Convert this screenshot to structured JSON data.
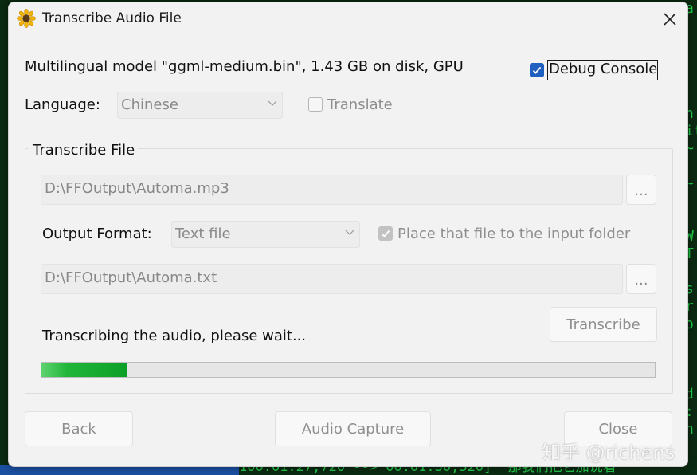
{
  "background": {
    "terminal_right_lines": [
      "a",
      "",
      "",
      "",
      "",
      "",
      "n",
      "it",
      "~",
      "",
      "~",
      "",
      "",
      "W",
      "T",
      "",
      "s",
      "r",
      "o",
      "",
      "",
      "",
      "d",
      ":",
      "h",
      "",
      "",
      "e"
    ],
    "terminal_bottom_text": "100:01:27,720 --> 00:01:30,320]  那我们把它加说着"
  },
  "window": {
    "title": "Transcribe Audio File",
    "model_info": "Multilingual model \"ggml-medium.bin\", 1.43 GB on disk, GPU",
    "debug_console": {
      "label": "Debug Console",
      "checked": true
    },
    "language": {
      "label": "Language:",
      "selected": "Chinese"
    },
    "translate": {
      "label": "Translate",
      "checked": false
    },
    "transcribe_group": {
      "label": "Transcribe File",
      "input_path": "D:\\FFOutput\\Automa.mp3",
      "browse_label": "...",
      "output_format": {
        "label": "Output Format:",
        "selected": "Text file"
      },
      "place_in_input_folder": {
        "label": "Place that file to the input folder",
        "checked": true
      },
      "output_path": "D:\\FFOutput\\Automa.txt",
      "output_browse_label": "...",
      "transcribe_button": "Transcribe",
      "status": "Transcribing the audio, please wait...",
      "progress": 0.14
    },
    "buttons": {
      "back": "Back",
      "audio_capture": "Audio Capture",
      "close": "Close"
    }
  },
  "watermark": "知乎 @richens",
  "colors": {
    "accent": "#1f5fbf",
    "progress": "#0c9f27",
    "terminal_text": "#1fd24a"
  }
}
